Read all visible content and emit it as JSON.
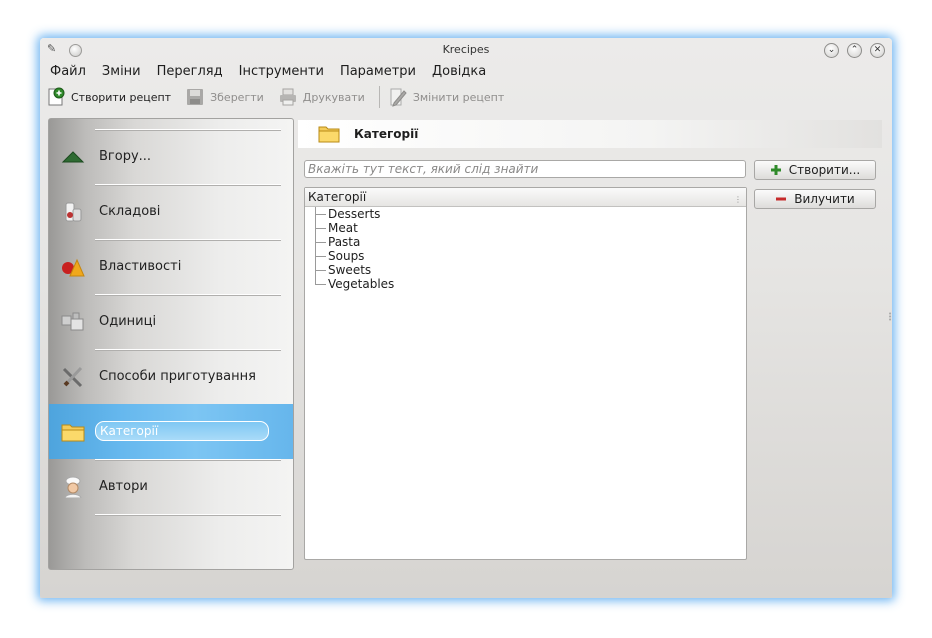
{
  "window": {
    "title": "Krecipes"
  },
  "menubar": [
    {
      "label": "Файл"
    },
    {
      "label": "Зміни"
    },
    {
      "label": "Перегляд"
    },
    {
      "label": "Інструменти"
    },
    {
      "label": "Параметри"
    },
    {
      "label": "Довідка"
    }
  ],
  "toolbar": {
    "new_recipe": "Створити рецепт",
    "save": "Зберегти",
    "print": "Друкувати",
    "edit_recipe": "Змінити рецепт"
  },
  "sidebar": {
    "items": [
      {
        "label": "Вгору...",
        "icon": "up-arrow-icon"
      },
      {
        "label": "Складові",
        "icon": "ingredients-icon"
      },
      {
        "label": "Властивості",
        "icon": "properties-icon"
      },
      {
        "label": "Одиниці",
        "icon": "units-icon"
      },
      {
        "label": "Способи приготування",
        "icon": "cooking-methods-icon"
      },
      {
        "label": "Категорії",
        "icon": "folder-icon",
        "active": true
      },
      {
        "label": "Автори",
        "icon": "chef-icon"
      }
    ],
    "help": "?"
  },
  "panel": {
    "title": "Категорії",
    "search_placeholder": "Вкажіть тут текст, який слід знайти",
    "create_button": "Створити...",
    "remove_button": "Вилучити",
    "tree": {
      "header": "Категорії",
      "rows": [
        "Desserts",
        "Meat",
        "Pasta",
        "Soups",
        "Sweets",
        "Vegetables"
      ]
    }
  },
  "colors": {
    "accent": "#66b8ee",
    "window_glow": "#5aaaf0"
  }
}
